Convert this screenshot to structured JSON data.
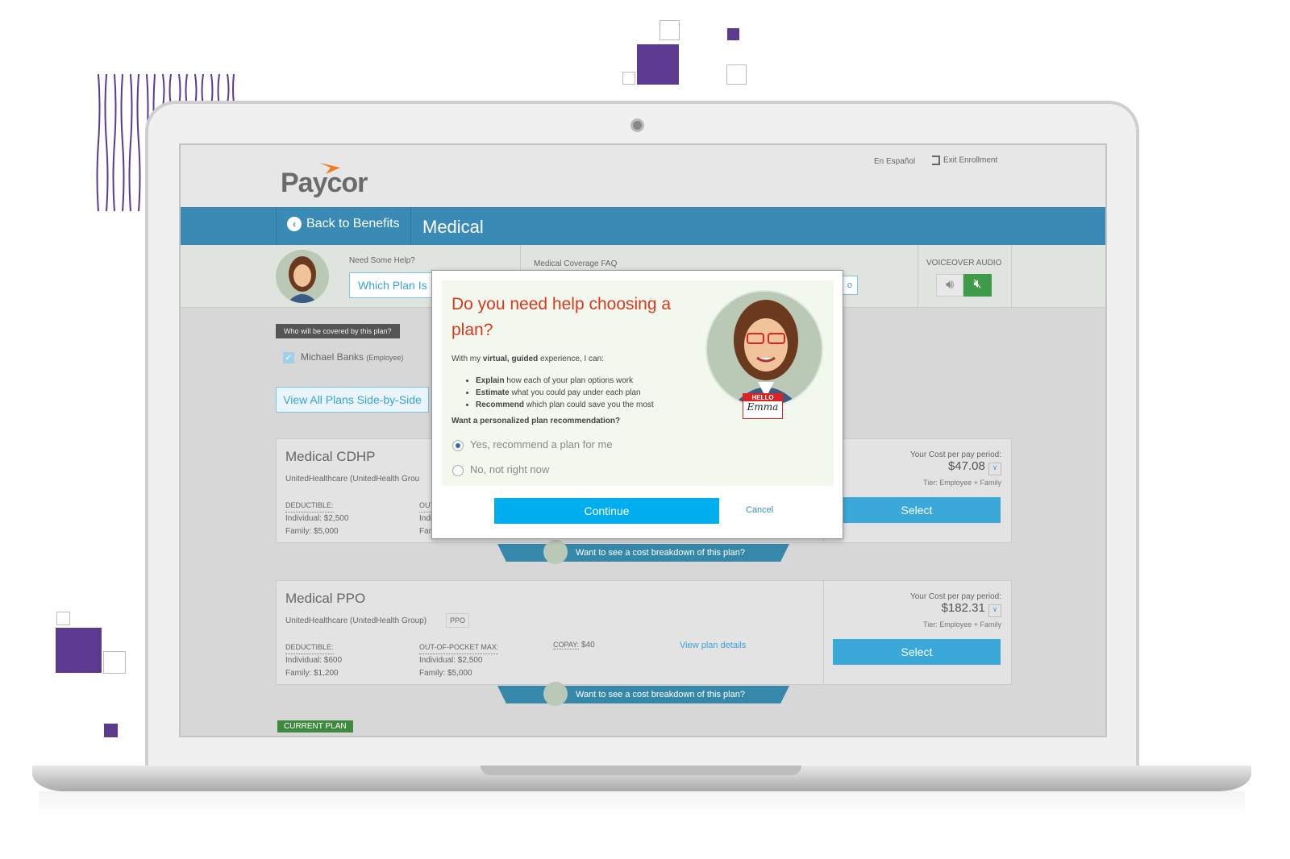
{
  "brand": {
    "logo": "Paycor",
    "accent": "#3a8ab6",
    "logo_accent": "#f47a20",
    "purple": "#5b3a8f"
  },
  "header": {
    "language_link": "En Español",
    "exit_label": "Exit Enrollment",
    "exit_icon": "exit-door-icon"
  },
  "nav": {
    "back_label": "Back to Benefits",
    "back_icon": "chevron-left-circle-icon",
    "title": "Medical"
  },
  "help_bar": {
    "need_help": "Need Some Help?",
    "which_plan_button": "Which Plan Is Right for Me?",
    "which_plan_visible": "Which Plan Is",
    "faq_label": "Medical Coverage FAQ",
    "faq_button_fragment": "o",
    "voiceover_label": "VOICEOVER AUDIO",
    "voice_on_icon": "speaker-icon",
    "voice_off_icon": "speaker-mute-icon"
  },
  "coverage": {
    "tag": "Who will be covered by this plan?",
    "member_name": "Michael Banks",
    "member_role": "(Employee)",
    "member_checked": true,
    "view_all_button": "View All Plans Side-by-Side"
  },
  "plans": [
    {
      "name": "Medical CDHP",
      "carrier": "UnitedHealthcare (UnitedHealth Grou",
      "deductible_label": "DEDUCTIBLE:",
      "deductible_individual": "Individual: $2,500",
      "deductible_family": "Family: $5,000",
      "oop_label": "OUT",
      "oop_individual": "Indi",
      "oop_family": "Fan",
      "cost_label": "Your Cost per pay period:",
      "cost": "$47.08",
      "tier": "Tier: Employee + Family",
      "select_label": "Select",
      "ribbon": "Want to see a cost breakdown of this plan?"
    },
    {
      "name": "Medical PPO",
      "carrier": "UnitedHealthcare (UnitedHealth Group)",
      "type_badge": "PPO",
      "deductible_label": "DEDUCTIBLE:",
      "deductible_individual": "Individual: $600",
      "deductible_family": "Family: $1,200",
      "oop_label": "OUT-OF-POCKET MAX:",
      "oop_individual": "Individual: $2,500",
      "oop_family": "Family: $5,000",
      "copay_label": "COPAY:",
      "copay": "$40",
      "details_link": "View plan details",
      "cost_label": "Your Cost per pay period:",
      "cost": "$182.31",
      "tier": "Tier: Employee + Family",
      "select_label": "Select",
      "ribbon": "Want to see a cost breakdown of this plan?"
    }
  ],
  "current_plan_badge": "CURRENT PLAN",
  "modal": {
    "title": "Do you need help choosing a plan?",
    "intro_pre": "With my ",
    "intro_bold": "virtual, guided",
    "intro_post": " experience, I can:",
    "bullets": [
      {
        "bold": "Explain",
        "text": " how each of your plan options work"
      },
      {
        "bold": "Estimate",
        "text": " what you could pay under each plan"
      },
      {
        "bold": "Recommend",
        "text": " which plan could save you the most"
      }
    ],
    "question": "Want a personalized plan recommendation?",
    "options": [
      {
        "label": "Yes, recommend a plan for me",
        "selected": true
      },
      {
        "label": "No, not right now",
        "selected": false
      }
    ],
    "continue_label": "Continue",
    "cancel_label": "Cancel",
    "badge_hello": "HELLO",
    "badge_name": "Emma",
    "title_color": "#d9381e",
    "button_color": "#00aeef"
  }
}
